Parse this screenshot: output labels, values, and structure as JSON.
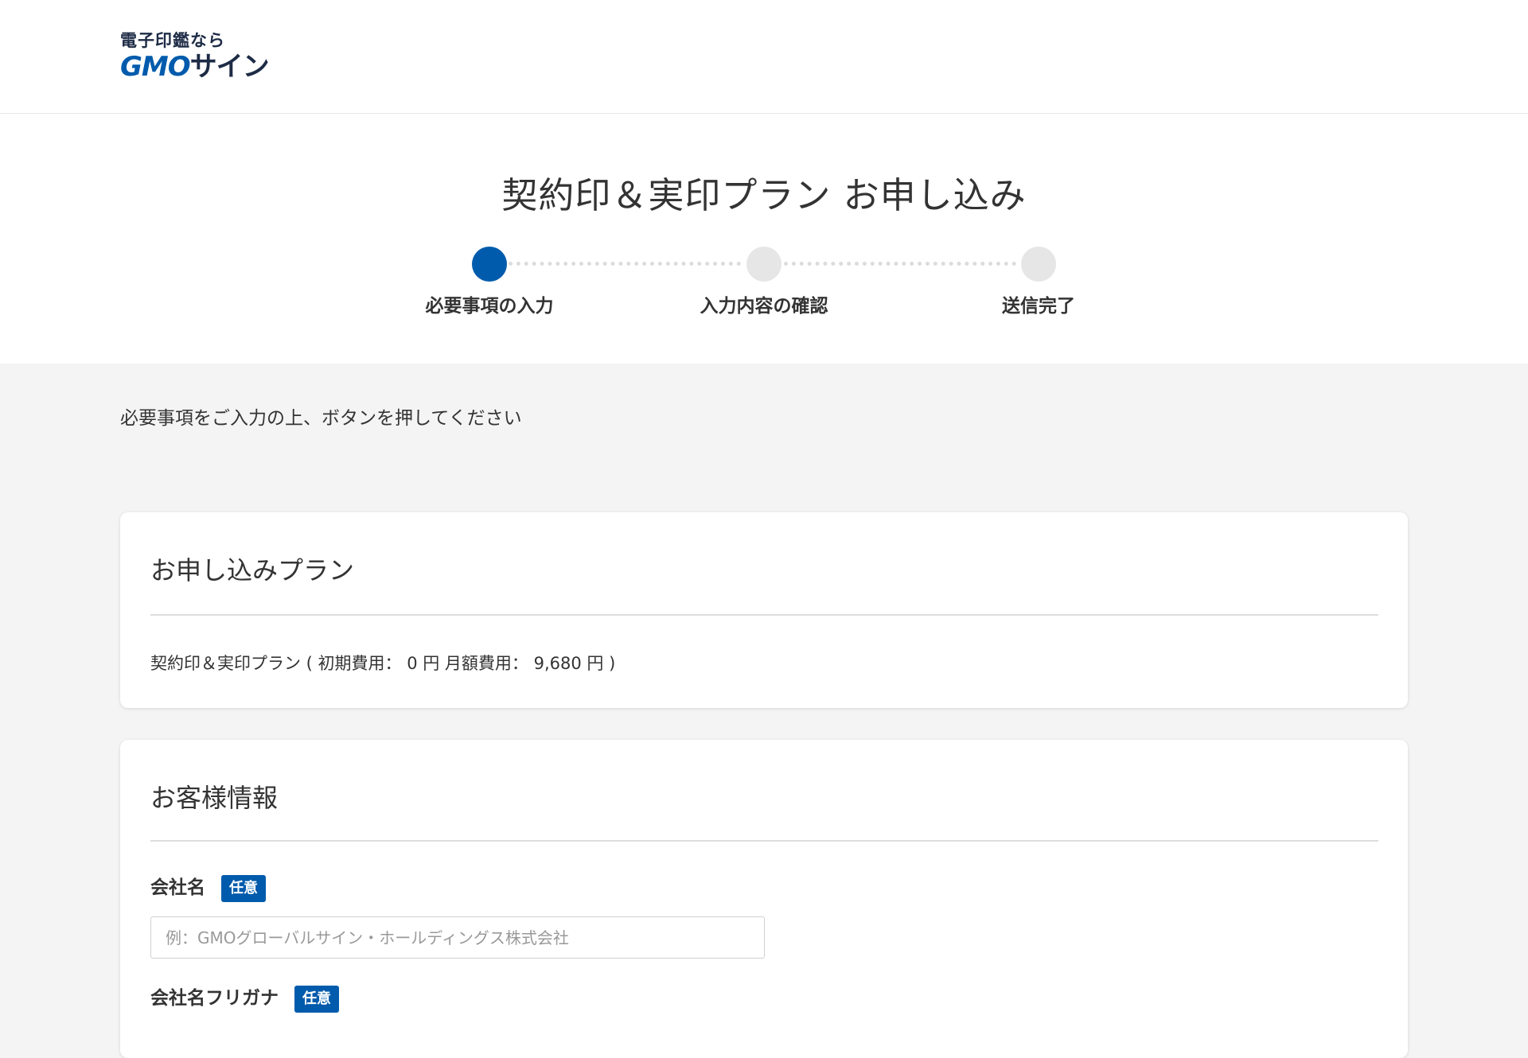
{
  "header": {
    "tagline": "電子印鑑なら",
    "logo_gmo": "GMO",
    "logo_sign": "サイン"
  },
  "hero": {
    "title": "契約印＆実印プラン お申し込み",
    "steps": [
      {
        "label": "必要事項の入力",
        "active": true
      },
      {
        "label": "入力内容の確認",
        "active": false
      },
      {
        "label": "送信完了",
        "active": false
      }
    ]
  },
  "instruction": "必要事項をご入力の上、ボタンを押してください",
  "plan_card": {
    "title": "お申し込みプラン",
    "plan_text": "契約印＆実印プラン ( 初期費用： 0 円 月額費用： 9,680 円 )"
  },
  "customer_card": {
    "title": "お客様情報",
    "fields": [
      {
        "label": "会社名",
        "badge": "任意",
        "placeholder": "例：GMOグローバルサイン・ホールディングス株式会社",
        "value": ""
      },
      {
        "label": "会社名フリガナ",
        "badge": "任意"
      }
    ]
  },
  "colors": {
    "accent": "#005bac",
    "background": "#f4f4f4",
    "step_inactive": "#e6e6e6"
  }
}
